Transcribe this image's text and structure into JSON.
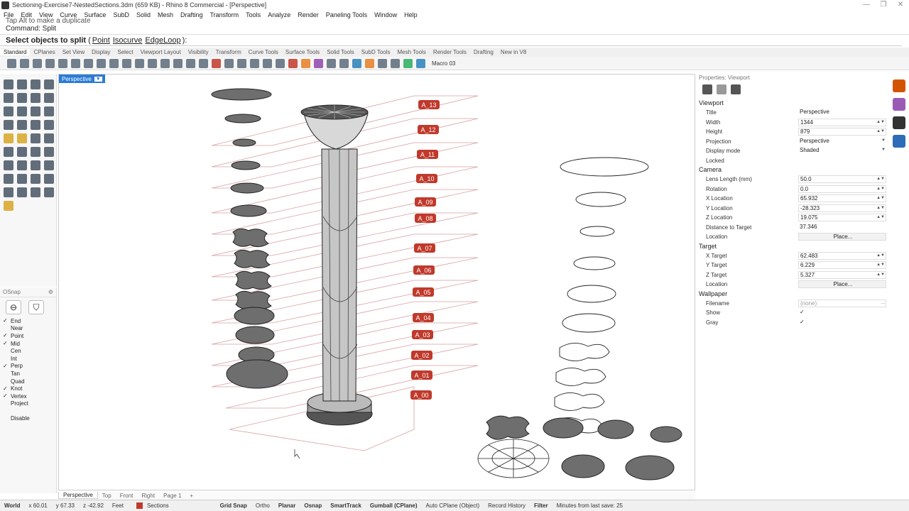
{
  "window": {
    "title": "Sectioning-Exercise7-NestedSections.3dm (659 KB) - Rhino 8 Commercial - [Perspective]",
    "controls": [
      "—",
      "❐",
      "✕"
    ]
  },
  "menu": [
    "File",
    "Edit",
    "View",
    "Curve",
    "Surface",
    "SubD",
    "Solid",
    "Mesh",
    "Drafting",
    "Transform",
    "Tools",
    "Analyze",
    "Render",
    "Paneling Tools",
    "Window",
    "Help"
  ],
  "command": {
    "history_line1": "Tap Alt to make a duplicate",
    "history_line2": "Command: Split",
    "prompt": "Select objects to split",
    "options_open": "(",
    "options": [
      "Point",
      "Isocurve",
      "EdgeLoop"
    ],
    "options_close": "):"
  },
  "toolbar_tabs": [
    "Standard",
    "CPlanes",
    "Set View",
    "Display",
    "Select",
    "Viewport Layout",
    "Visibility",
    "Transform",
    "Curve Tools",
    "Surface Tools",
    "Solid Tools",
    "SubD Tools",
    "Mesh Tools",
    "Render Tools",
    "Drafting",
    "New in V8"
  ],
  "toolbar": {
    "macro": "Macro 03"
  },
  "osnap": {
    "header": "OSnap",
    "items": [
      {
        "label": "End",
        "checked": true
      },
      {
        "label": "Near",
        "checked": false
      },
      {
        "label": "Point",
        "checked": true
      },
      {
        "label": "Mid",
        "checked": true
      },
      {
        "label": "Cen",
        "checked": false
      },
      {
        "label": "Int",
        "checked": false
      },
      {
        "label": "Perp",
        "checked": true
      },
      {
        "label": "Tan",
        "checked": false
      },
      {
        "label": "Quad",
        "checked": false
      },
      {
        "label": "Knot",
        "checked": true
      },
      {
        "label": "Vertex",
        "checked": true
      },
      {
        "label": "Project",
        "checked": false
      }
    ],
    "disable": "Disable"
  },
  "viewport": {
    "tab": "Perspective",
    "section_labels": [
      "A_13",
      "A_12",
      "A_11",
      "A_10",
      "A_09",
      "A_08",
      "A_07",
      "A_06",
      "A_05",
      "A_04",
      "A_03",
      "A_02",
      "A_01",
      "A_00"
    ],
    "label_color": "#c0392b"
  },
  "view_tabs": [
    "Perspective",
    "Top",
    "Front",
    "Right",
    "Page 1",
    "+"
  ],
  "status": {
    "cplane": "World",
    "x": "x 60.01",
    "y": "y 67.33",
    "z": "z -42.92",
    "units": "Feet",
    "layer": "Sections",
    "toggles": [
      "Grid Snap",
      "Ortho",
      "Planar",
      "Osnap",
      "SmartTrack",
      "Gumball (CPlane)",
      "Auto CPlane (Object)",
      "Record History",
      "Filter"
    ],
    "save": "Minutes from last save: 25"
  },
  "properties": {
    "header": "Properties: Viewport",
    "viewport_section": "Viewport",
    "viewport_rows": [
      {
        "label": "Title",
        "value": "Perspective"
      },
      {
        "label": "Width",
        "value": "1344"
      },
      {
        "label": "Height",
        "value": "879"
      },
      {
        "label": "Projection",
        "value": "Perspective"
      },
      {
        "label": "Display mode",
        "value": "Shaded"
      },
      {
        "label": "Locked",
        "value": ""
      }
    ],
    "camera_section": "Camera",
    "camera_rows": [
      {
        "label": "Lens Length (mm)",
        "value": "50.0"
      },
      {
        "label": "Rotation",
        "value": "0.0"
      },
      {
        "label": "X Location",
        "value": "65.932"
      },
      {
        "label": "Y Location",
        "value": "-28.323"
      },
      {
        "label": "Z Location",
        "value": "19.075"
      },
      {
        "label": "Distance to Target",
        "value": "37.346"
      },
      {
        "label": "Location",
        "value": "Place..."
      }
    ],
    "target_section": "Target",
    "target_rows": [
      {
        "label": "X Target",
        "value": "62.483"
      },
      {
        "label": "Y Target",
        "value": "6.229"
      },
      {
        "label": "Z Target",
        "value": "5.327"
      },
      {
        "label": "Location",
        "value": "Place..."
      }
    ],
    "wallpaper_section": "Wallpaper",
    "wallpaper_rows": [
      {
        "label": "Filename",
        "value": "(none)"
      },
      {
        "label": "Show",
        "value": "✓"
      },
      {
        "label": "Gray",
        "value": "✓"
      }
    ]
  }
}
